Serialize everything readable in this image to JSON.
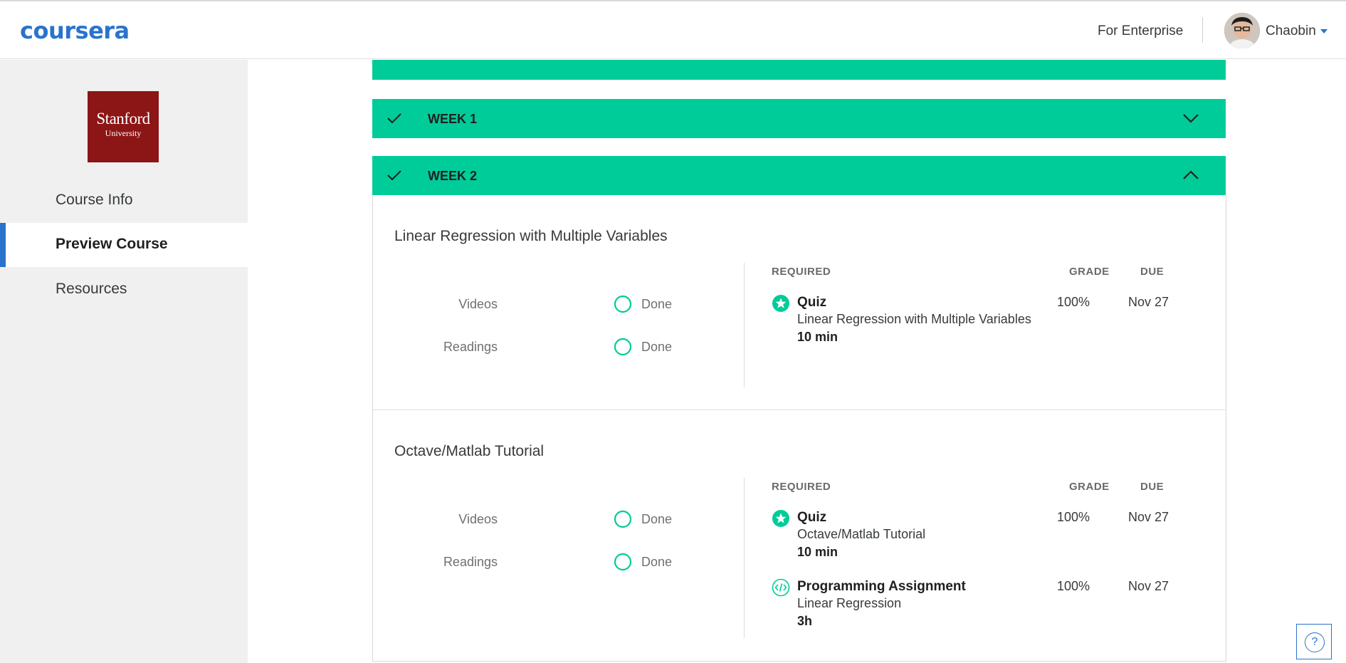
{
  "header": {
    "logo": "coursera",
    "for_enterprise": "For Enterprise",
    "username": "Chaobin",
    "avatar_icon": "user-avatar",
    "dropdown_icon": "caret-down-icon"
  },
  "sidebar": {
    "university_logo": {
      "line1": "Stanford",
      "line2": "University",
      "color": "#8c1515"
    },
    "items": [
      {
        "label": "Course Info",
        "active": false
      },
      {
        "label": "Preview Course",
        "active": true
      },
      {
        "label": "Resources",
        "active": false
      }
    ]
  },
  "weeks": [
    {
      "label": "WEEK 1",
      "completed": true,
      "expanded": false
    },
    {
      "label": "WEEK 2",
      "completed": true,
      "expanded": true
    }
  ],
  "lessons": [
    {
      "title": "Linear Regression with Multiple Variables",
      "progress": [
        {
          "name": "Videos",
          "status": "Done"
        },
        {
          "name": "Readings",
          "status": "Done"
        }
      ],
      "headers": {
        "required": "REQUIRED",
        "grade": "GRADE",
        "due": "DUE"
      },
      "items": [
        {
          "icon": "quiz-star-icon",
          "type": "Quiz",
          "name": "Linear Regression with Multiple Variables",
          "duration": "10 min",
          "grade": "100%",
          "due": "Nov 27"
        }
      ]
    },
    {
      "title": "Octave/Matlab Tutorial",
      "progress": [
        {
          "name": "Videos",
          "status": "Done"
        },
        {
          "name": "Readings",
          "status": "Done"
        }
      ],
      "headers": {
        "required": "REQUIRED",
        "grade": "GRADE",
        "due": "DUE"
      },
      "items": [
        {
          "icon": "quiz-star-icon",
          "type": "Quiz",
          "name": "Octave/Matlab Tutorial",
          "duration": "10 min",
          "grade": "100%",
          "due": "Nov 27"
        },
        {
          "icon": "code-icon",
          "type": "Programming Assignment",
          "name": "Linear Regression",
          "duration": "3h",
          "grade": "100%",
          "due": "Nov 27"
        }
      ]
    }
  ],
  "help": {
    "icon": "question-icon",
    "symbol": "?"
  },
  "colors": {
    "accent": "#2a73cc",
    "success": "#00cc99",
    "brand_logo": "#2a73cc"
  }
}
